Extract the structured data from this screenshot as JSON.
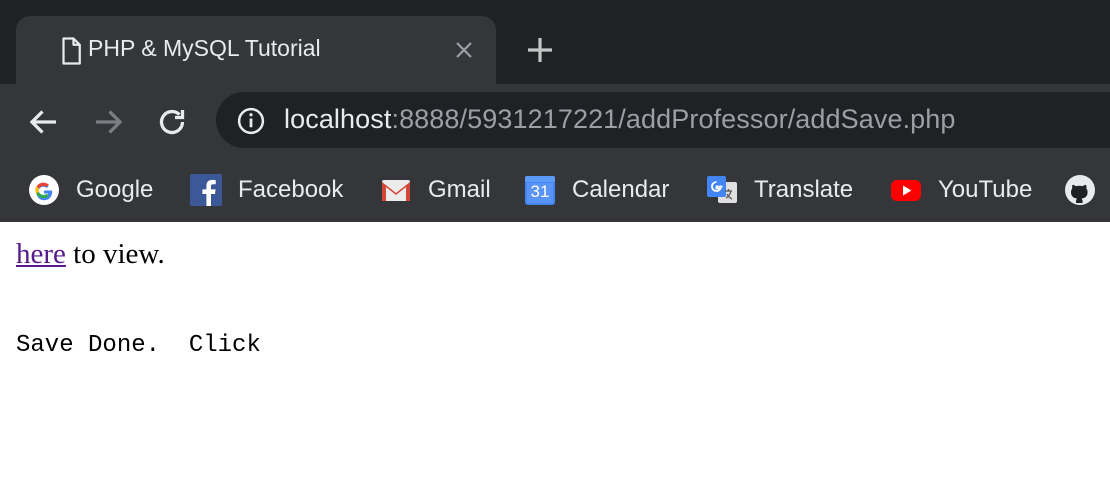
{
  "tab": {
    "title": "PHP & MySQL Tutorial",
    "icons": {
      "page": "document-icon",
      "close": "close-icon",
      "new_tab": "plus-icon"
    }
  },
  "toolbar": {
    "icons": {
      "back": "back-arrow-icon",
      "forward": "forward-arrow-icon",
      "reload": "reload-icon",
      "info": "info-icon"
    },
    "url_host": "localhost",
    "url_path": ":8888/5931217221/addProfessor/addSave.php"
  },
  "bookmarks": [
    {
      "label": "Google",
      "icon": "google-icon"
    },
    {
      "label": "Facebook",
      "icon": "facebook-icon"
    },
    {
      "label": "Gmail",
      "icon": "gmail-icon"
    },
    {
      "label": "Calendar",
      "icon": "calendar-icon",
      "badge": "31"
    },
    {
      "label": "Translate",
      "icon": "translate-icon"
    },
    {
      "label": "YouTube",
      "icon": "youtube-icon"
    },
    {
      "label": "",
      "icon": "github-icon"
    }
  ],
  "page": {
    "link_text": "here",
    "after_link": " to view.",
    "message": "Save Done.  Click"
  },
  "colors": {
    "chrome_dark": "#202124",
    "chrome_toolbar": "#35363a",
    "visited_link": "#551a8b"
  }
}
